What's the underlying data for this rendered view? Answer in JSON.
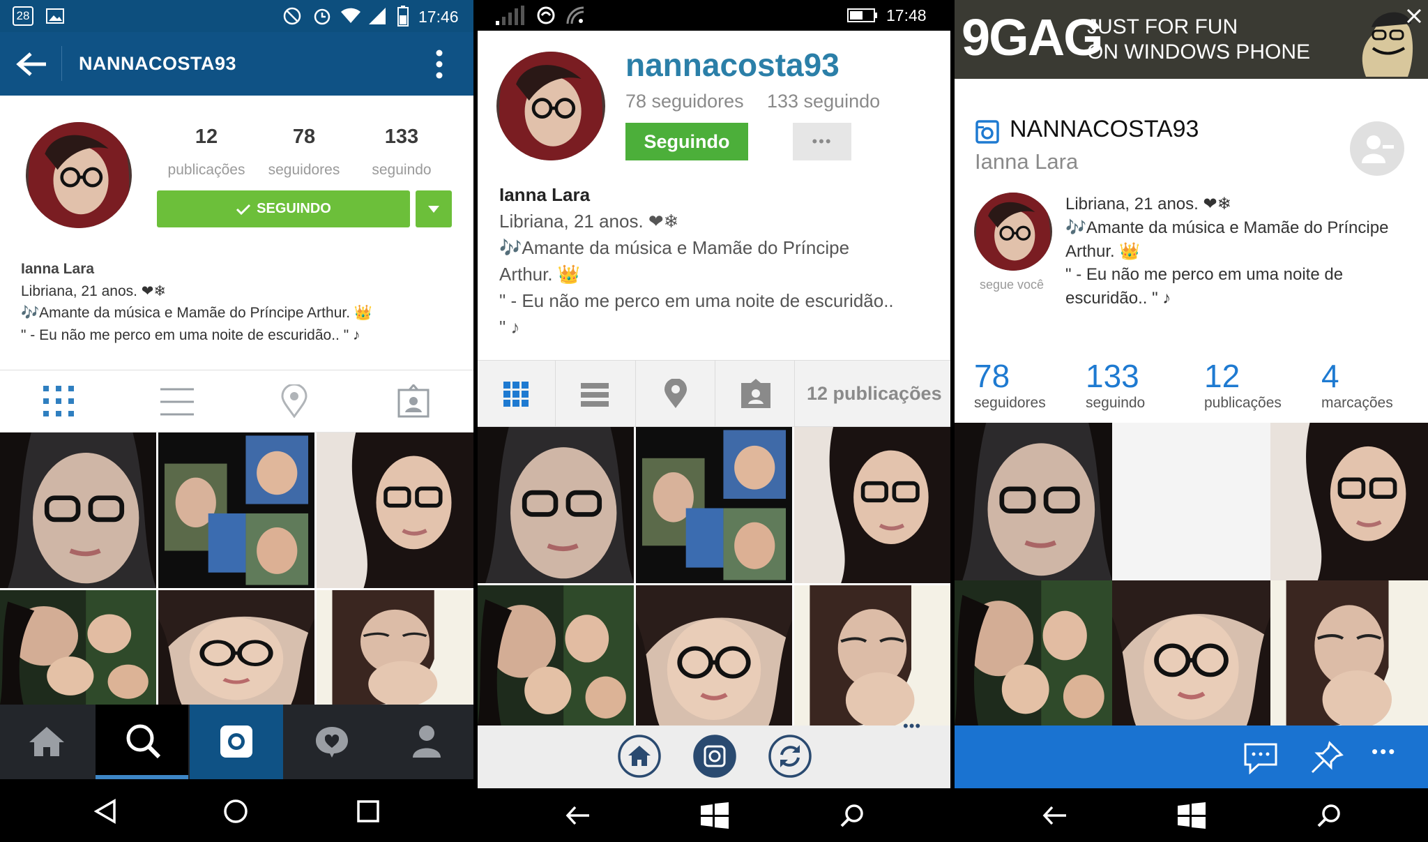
{
  "android": {
    "status": {
      "date_badge": "28",
      "time": "17:46"
    },
    "toolbar": {
      "title": "NANNACOSTA93"
    },
    "stats": [
      {
        "value": "12",
        "label": "publicações"
      },
      {
        "value": "78",
        "label": "seguidores"
      },
      {
        "value": "133",
        "label": "seguindo"
      }
    ],
    "follow_button": "SEGUINDO",
    "bio": {
      "name": "Ianna Lara",
      "line1": "Libriana,  21 anos. ❤❄",
      "line2": "🎶Amante da música e Mamãe do Príncipe Arthur. 👑",
      "line3": "\" - Eu não me perco em uma noite de escuridão.. \" ♪"
    }
  },
  "wp_app": {
    "status": {
      "time": "17:48"
    },
    "username": "nannacosta93",
    "followers": "78 seguidores",
    "following": "133 seguindo",
    "follow_button": "Seguindo",
    "more_button": "•••",
    "bio": {
      "name": "Ianna Lara",
      "line1": "Libriana,  21 anos. ❤❄",
      "line2a": "🎶Amante da música e Mamãe do Príncipe",
      "line2b": "Arthur. 👑",
      "line3a": "\" - Eu não me perco em uma noite de escuridão..",
      "line3b": "\" ♪"
    },
    "posts_count": "12 publicações",
    "appbar_more": "•••"
  },
  "sixgram": {
    "ad": {
      "brand": "9GAG",
      "line1": "JUST FOR FUN",
      "line2": "ON WINDOWS PHONE"
    },
    "username": "NANNACOSTA93",
    "full_name": "Ianna Lara",
    "follows_you": "segue você",
    "bio": {
      "line1": "Libriana,  21 anos. ❤❄",
      "line2a": "🎶Amante da música e Mamãe do Príncipe",
      "line2b": "Arthur. 👑",
      "line3a": "\" - Eu não me perco em uma noite de",
      "line3b": "escuridão.. \" ♪"
    },
    "stats": [
      {
        "value": "78",
        "label": "seguidores"
      },
      {
        "value": "133",
        "label": "seguindo"
      },
      {
        "value": "12",
        "label": "publicações"
      },
      {
        "value": "4",
        "label": "marcações"
      }
    ],
    "appbar_more": "•••"
  },
  "colors": {
    "android_primary": "#0f5285",
    "follow_green": "#6cbf3a",
    "wp_green": "#4caf3a",
    "wp_blue": "#1a73d1",
    "link_blue": "#1e7ad1",
    "username_teal": "#2b7fa8"
  }
}
